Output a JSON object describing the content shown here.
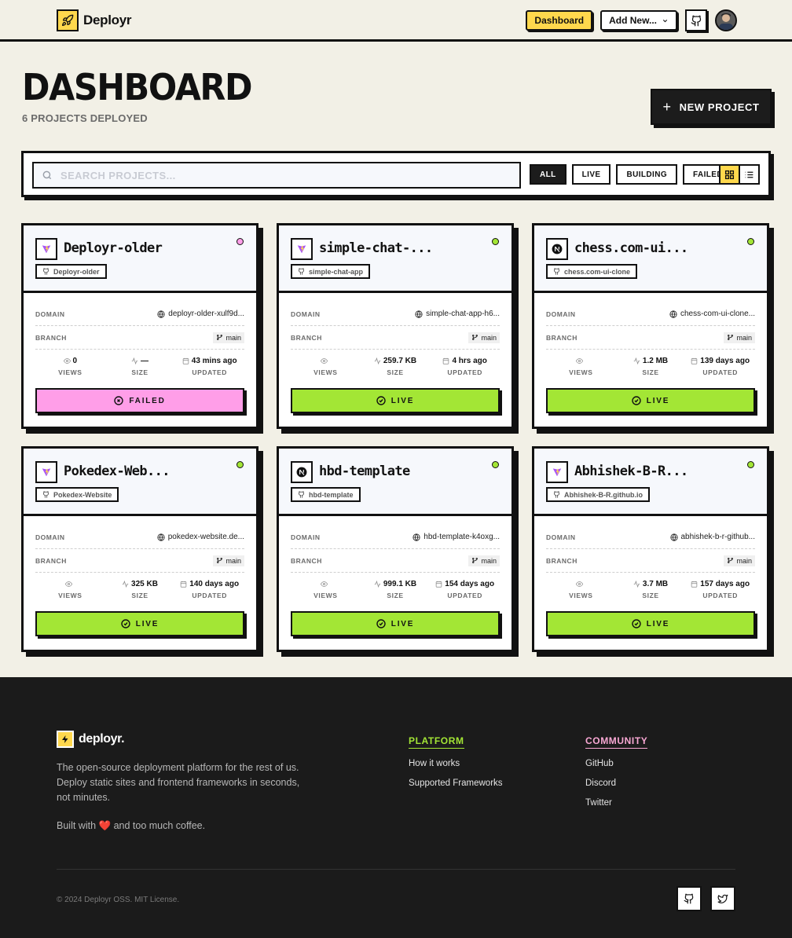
{
  "nav": {
    "brand": "Deployr",
    "dashboard_label": "Dashboard",
    "add_new_label": "Add New..."
  },
  "header": {
    "title": "DASHBOARD",
    "subtitle": "6 PROJECTS DEPLOYED",
    "new_project_label": "NEW PROJECT"
  },
  "toolbar": {
    "search_placeholder": "SEARCH PROJECTS...",
    "filters": [
      "ALL",
      "LIVE",
      "BUILDING",
      "FAILED"
    ],
    "active_filter": "ALL",
    "active_view": "grid"
  },
  "labels": {
    "domain": "DOMAIN",
    "branch": "BRANCH",
    "views": "VIEWS",
    "size": "SIZE",
    "updated": "UPDATED"
  },
  "projects": [
    {
      "name": "Deployr-older",
      "repo": "Deployr-older",
      "framework": "vite-icon",
      "domain": "deployr-older-xulf9d...",
      "branch": "main",
      "views": "0",
      "size": "—",
      "updated": "43 mins ago",
      "status": "FAILED",
      "dot_color": "#ff9ee8"
    },
    {
      "name": "simple-chat-...",
      "repo": "simple-chat-app",
      "framework": "vite-icon",
      "domain": "simple-chat-app-h6...",
      "branch": "main",
      "views": "",
      "size": "259.7 KB",
      "updated": "4 hrs ago",
      "status": "LIVE",
      "dot_color": "#a3e635"
    },
    {
      "name": "chess.com-ui...",
      "repo": "chess.com-ui-clone",
      "framework": "nextjs-icon",
      "domain": "chess-com-ui-clone...",
      "branch": "main",
      "views": "",
      "size": "1.2 MB",
      "updated": "139 days ago",
      "status": "LIVE",
      "dot_color": "#a3e635"
    },
    {
      "name": "Pokedex-Web...",
      "repo": "Pokedex-Website",
      "framework": "vite-icon",
      "domain": "pokedex-website.de...",
      "branch": "main",
      "views": "",
      "size": "325 KB",
      "updated": "140 days ago",
      "status": "LIVE",
      "dot_color": "#a3e635"
    },
    {
      "name": "hbd-template",
      "repo": "hbd-template",
      "framework": "nextjs-icon",
      "domain": "hbd-template-k4oxg...",
      "branch": "main",
      "views": "",
      "size": "999.1 KB",
      "updated": "154 days ago",
      "status": "LIVE",
      "dot_color": "#a3e635"
    },
    {
      "name": "Abhishek-B-R...",
      "repo": "Abhishek-B-R.github.io",
      "framework": "vite-icon",
      "domain": "abhishek-b-r-github...",
      "branch": "main",
      "views": "",
      "size": "3.7 MB",
      "updated": "157 days ago",
      "status": "LIVE",
      "dot_color": "#a3e635"
    }
  ],
  "footer": {
    "brand": "deployr.",
    "description": "The open-source deployment platform for the rest of us. Deploy static sites and frontend frameworks in seconds, not minutes.",
    "built_prefix": "Built with",
    "built_suffix": "and too much coffee.",
    "platform_title": "PLATFORM",
    "platform_links": [
      "How it works",
      "Supported Frameworks"
    ],
    "community_title": "COMMUNITY",
    "community_links": [
      "GitHub",
      "Discord",
      "Twitter"
    ],
    "copyright": "© 2024 Deployr OSS. MIT License.",
    "platform_color": "#a3e635",
    "community_color": "#f9a8d4"
  },
  "colors": {
    "accent_yellow": "#ffd84d",
    "live_green": "#a3e635",
    "failed_pink": "#ff9ee8",
    "ink": "#111111",
    "background": "#f2f0e6"
  }
}
